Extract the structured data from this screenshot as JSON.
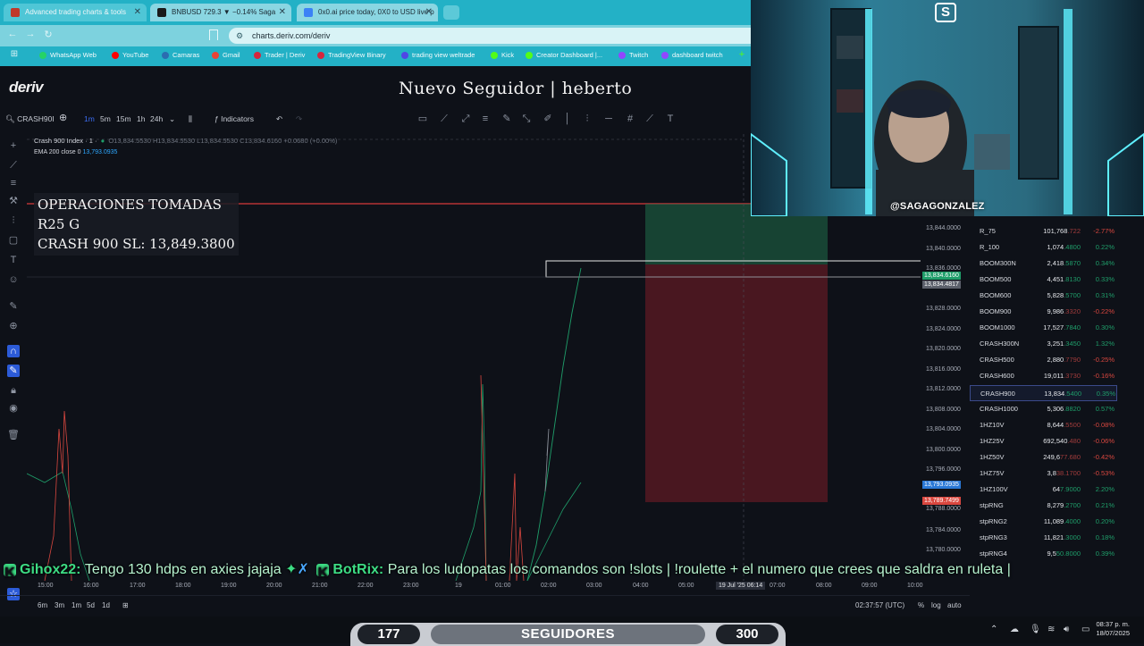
{
  "browser": {
    "tabs": [
      {
        "label": "Advanced trading charts & tools",
        "color": "#c0392b"
      },
      {
        "label": "BNBUSD 729.3 ▼ −0.14% Saga",
        "color": "#1a1a1a"
      },
      {
        "label": "0x0.ai price today, 0X0 to USD live p",
        "color": "#3b82f6"
      }
    ],
    "url": "charts.deriv.com/deriv",
    "bookmarks": [
      {
        "label": "WhatsApp Web",
        "color": "#25d366"
      },
      {
        "label": "YouTube",
        "color": "#ff0000"
      },
      {
        "label": "Camaras",
        "color": "#2b6cb0"
      },
      {
        "label": "Gmail",
        "color": "#ea4335"
      },
      {
        "label": "Trader | Deriv",
        "color": "#d7263d"
      },
      {
        "label": "TradingView Binary",
        "color": "#d7263d"
      },
      {
        "label": "trading view weltrade",
        "color": "#4f46e5"
      },
      {
        "label": "Kick",
        "color": "#53fc18"
      },
      {
        "label": "Creator Dashboard |...",
        "color": "#53fc18"
      },
      {
        "label": "Twitch",
        "color": "#9146ff"
      },
      {
        "label": "dashboard twitch",
        "color": "#9146ff"
      }
    ]
  },
  "app": {
    "logo": "deriv",
    "overlay_title": "Nuevo Seguidor | heberto",
    "toolbar": {
      "symbol": "CRASH90I",
      "intervals": [
        "1m",
        "5m",
        "15m",
        "1h",
        "24h"
      ],
      "active_interval": "1m",
      "indicators_label": "Indicators"
    },
    "legend": {
      "name": "Crash 900 Index · 1 ·",
      "ohlc": "O13,834.5530 H13,834.5530 L13,834.5530 C13,834.6160 +0.0680 (+0.00%)",
      "ema_label": "EMA 200 close 0",
      "ema_value": "13,793.0935"
    },
    "operations": {
      "line1": "OPERACIONES TOMADAS",
      "line2": "R25 G",
      "line3": "CRASH 900 SL: 13,849.3800"
    },
    "yaxis": {
      "ticks": [
        "13,844.0000",
        "13,840.0000",
        "13,836.0000",
        "13,828.0000",
        "13,824.0000",
        "13,820.0000",
        "13,816.0000",
        "13,812.0000",
        "13,808.0000",
        "13,804.0000",
        "13,800.0000",
        "13,796.0000",
        "13,788.0000",
        "13,784.0000",
        "13,780.0000"
      ],
      "price_label": "13,834.6160",
      "price_label_sub": "13,834.4817",
      "ema_label": "13,793.0935",
      "red_label": "13,789.7499"
    },
    "xaxis": {
      "ticks": [
        "15:00",
        "16:00",
        "17:00",
        "18:00",
        "19:00",
        "20:00",
        "21:00",
        "22:00",
        "23:00",
        "19",
        "01:00",
        "02:00",
        "03:00",
        "04:00",
        "05:00",
        "07:00",
        "08:00",
        "09:00",
        "10:00"
      ],
      "crosshair_label": "19 Jul '25   06:14"
    },
    "bottombar": {
      "ranges": [
        "6m",
        "3m",
        "1m",
        "5d",
        "1d"
      ],
      "clock": "02:37:57 (UTC)",
      "percent": "%",
      "log": "log",
      "auto": "auto"
    }
  },
  "watchlist": [
    {
      "symbol": "R_75",
      "price": "101,768",
      "dec": ".722",
      "change": "-2.77%",
      "up": false
    },
    {
      "symbol": "R_100",
      "price": "1,074",
      "dec": ".4800",
      "change": "0.22%",
      "up": true
    },
    {
      "symbol": "BOOM300N",
      "price": "2,418",
      "dec": ".5870",
      "change": "0.34%",
      "up": true
    },
    {
      "symbol": "BOOM500",
      "price": "4,451",
      "dec": ".8130",
      "change": "0.33%",
      "up": true
    },
    {
      "symbol": "BOOM600",
      "price": "5,828",
      "dec": ".5700",
      "change": "0.31%",
      "up": true
    },
    {
      "symbol": "BOOM900",
      "price": "9,986",
      "dec": ".3320",
      "change": "-0.22%",
      "up": false
    },
    {
      "symbol": "BOOM1000",
      "price": "17,527",
      "dec": ".7840",
      "change": "0.30%",
      "up": true
    },
    {
      "symbol": "CRASH300N",
      "price": "3,251",
      "dec": ".3450",
      "change": "1.32%",
      "up": true
    },
    {
      "symbol": "CRASH500",
      "price": "2,880",
      "dec": ".7790",
      "change": "-0.25%",
      "up": false
    },
    {
      "symbol": "CRASH600",
      "price": "19,011",
      "dec": ".3730",
      "change": "-0.16%",
      "up": false
    },
    {
      "symbol": "CRASH900",
      "price": "13,834",
      "dec": ".5400",
      "change": "0.35%",
      "up": true
    },
    {
      "symbol": "CRASH1000",
      "price": "5,306",
      "dec": ".8820",
      "change": "0.57%",
      "up": true
    },
    {
      "symbol": "1HZ10V",
      "price": "8,644",
      "dec": ".5500",
      "change": "-0.08%",
      "up": false
    },
    {
      "symbol": "1HZ25V",
      "price": "692,540",
      "dec": ".480",
      "change": "-0.06%",
      "up": false
    },
    {
      "symbol": "1HZ50V",
      "price": "249,6",
      "dec": "77.680",
      "change": "-0.42%",
      "up": false
    },
    {
      "symbol": "1HZ75V",
      "price": "3,8",
      "dec": "38.1700",
      "change": "-0.53%",
      "up": false
    },
    {
      "symbol": "1HZ100V",
      "price": "64",
      "dec": "7.9000",
      "change": "2.20%",
      "up": true
    },
    {
      "symbol": "stpRNG",
      "price": "8,279",
      "dec": ".2700",
      "change": "0.21%",
      "up": true
    },
    {
      "symbol": "stpRNG2",
      "price": "11,089",
      "dec": ".4000",
      "change": "0.20%",
      "up": true
    },
    {
      "symbol": "stpRNG3",
      "price": "11,821",
      "dec": ".3000",
      "change": "0.18%",
      "up": true
    },
    {
      "symbol": "stpRNG4",
      "price": "9,5",
      "dec": "50.8000",
      "change": "0.39%",
      "up": true
    }
  ],
  "webcam": {
    "handle": "@SAGAGONZALEZ",
    "logo": "S"
  },
  "chat": {
    "user1": "Gihox22:",
    "msg1": "Tengo 130 hdps en axies jajaja",
    "user2": "BotRix:",
    "msg2": "Para los ludopatas los comandos son !slots | !roulette + el numero que crees que saldra en ruleta |"
  },
  "followers": {
    "current": "177",
    "label": "SEGUIDORES",
    "goal": "300"
  },
  "taskbar": {
    "time": "08:37 p. m.",
    "date": "18/07/2025"
  },
  "colors": {
    "up": "#1f9e6a",
    "down": "#d9473f",
    "accent": "#2c5bd8"
  }
}
